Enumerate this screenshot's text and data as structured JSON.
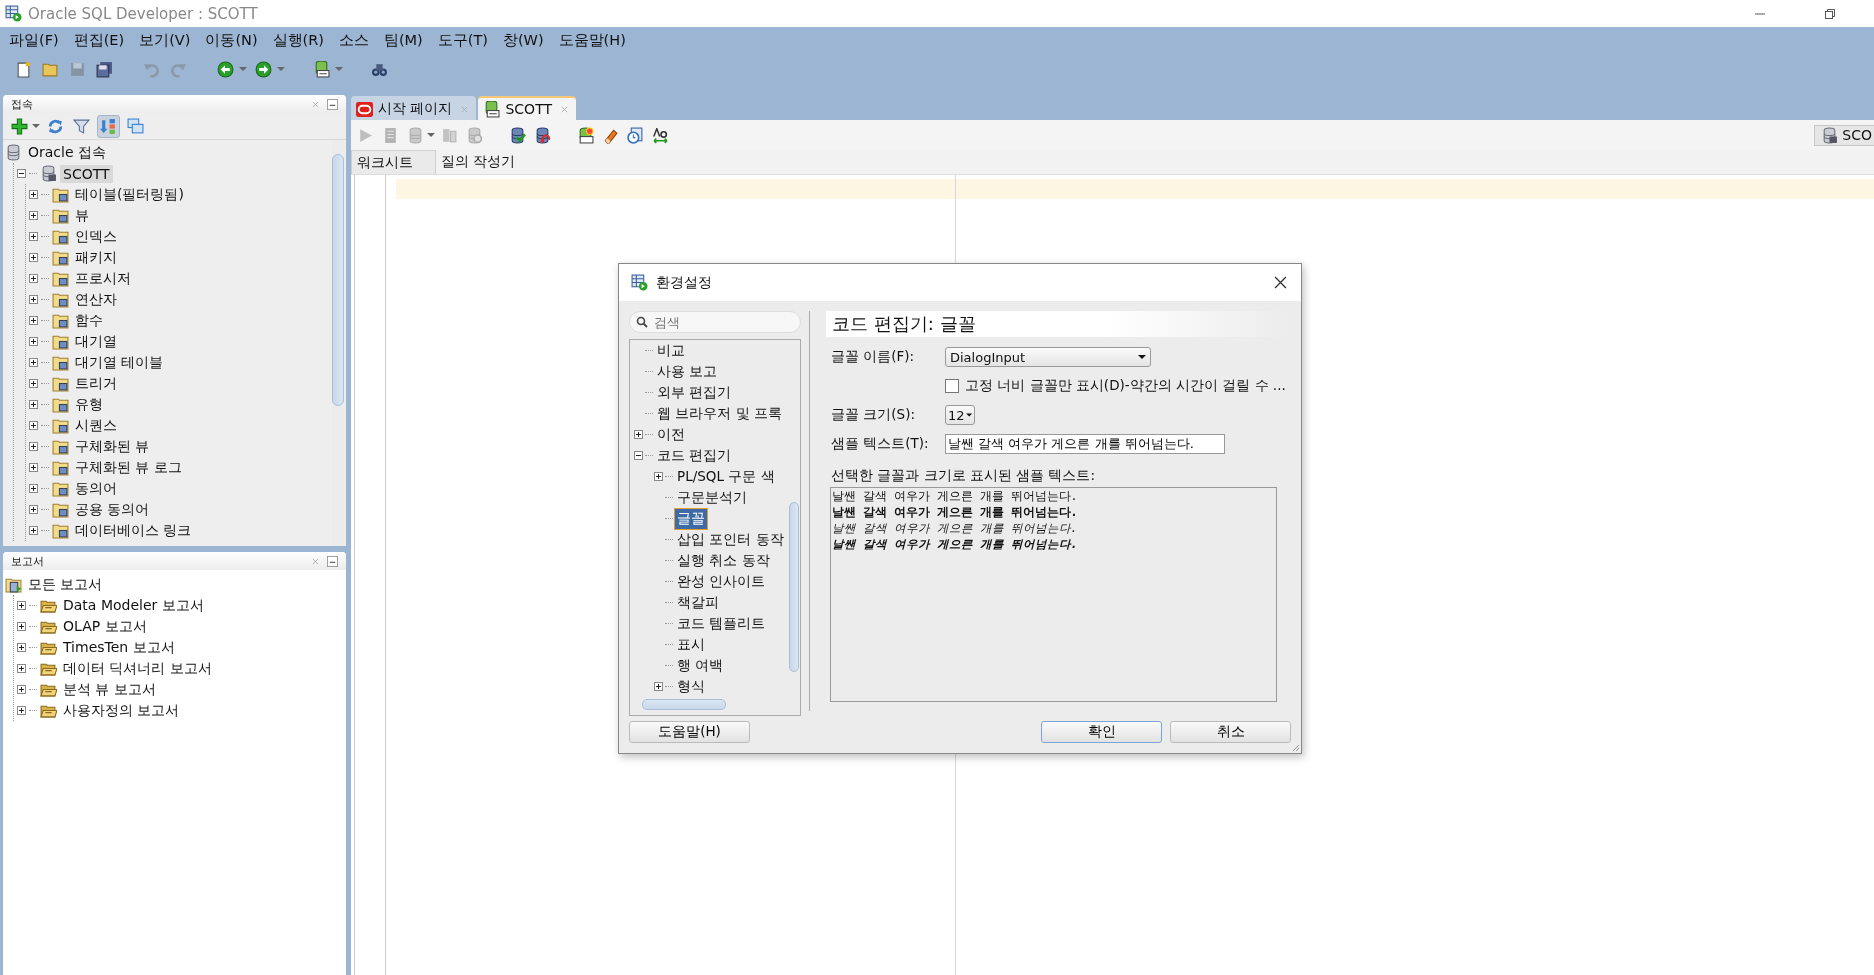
{
  "window": {
    "title": "Oracle SQL Developer : SCOTT"
  },
  "menu": [
    "파일(F)",
    "편집(E)",
    "보기(V)",
    "이동(N)",
    "실행(R)",
    "소스",
    "팀(M)",
    "도구(T)",
    "창(W)",
    "도움말(H)"
  ],
  "toolbar": [
    {
      "kind": "new-file",
      "disabled": false,
      "dropdown": false
    },
    {
      "kind": "open",
      "disabled": false,
      "dropdown": false
    },
    {
      "kind": "save",
      "disabled": true,
      "dropdown": false
    },
    {
      "kind": "save-all",
      "disabled": false,
      "dropdown": false
    },
    {
      "kind": "undo",
      "disabled": true,
      "dropdown": false
    },
    {
      "kind": "redo",
      "disabled": true,
      "dropdown": false
    },
    {
      "kind": "back",
      "disabled": false,
      "dropdown": true
    },
    {
      "kind": "forward",
      "disabled": false,
      "dropdown": true
    },
    {
      "kind": "sql",
      "disabled": false,
      "dropdown": true
    },
    {
      "kind": "find",
      "disabled": false,
      "dropdown": false
    }
  ],
  "connections_panel": {
    "title": "접속",
    "toolbar": [
      {
        "kind": "add",
        "on": false,
        "dropdown": true
      },
      {
        "kind": "refresh",
        "on": false,
        "dropdown": false
      },
      {
        "kind": "filter",
        "on": false,
        "dropdown": false
      },
      {
        "kind": "schema",
        "on": true,
        "dropdown": false
      },
      {
        "kind": "collapse",
        "on": false,
        "dropdown": false
      }
    ],
    "tree": [
      {
        "label": "Oracle 접속",
        "kind": "database",
        "selected": false,
        "children": [
          {
            "label": "SCOTT",
            "kind": "connection",
            "selected": true,
            "expanded": true,
            "children": [
              {
                "label": "테이블(필터링됨)",
                "kind": "folder",
                "selected": false,
                "expanded": false
              },
              {
                "label": "뷰",
                "kind": "folder",
                "selected": false,
                "expanded": false
              },
              {
                "label": "인덱스",
                "kind": "folder",
                "selected": false,
                "expanded": false
              },
              {
                "label": "패키지",
                "kind": "folder",
                "selected": false,
                "expanded": false
              },
              {
                "label": "프로시저",
                "kind": "folder",
                "selected": false,
                "expanded": false
              },
              {
                "label": "연산자",
                "kind": "folder",
                "selected": false,
                "expanded": false
              },
              {
                "label": "함수",
                "kind": "folder",
                "selected": false,
                "expanded": false
              },
              {
                "label": "대기열",
                "kind": "folder",
                "selected": false,
                "expanded": false
              },
              {
                "label": "대기열 테이블",
                "kind": "folder",
                "selected": false,
                "expanded": false
              },
              {
                "label": "트리거",
                "kind": "folder",
                "selected": false,
                "expanded": false
              },
              {
                "label": "유형",
                "kind": "folder",
                "selected": false,
                "expanded": false
              },
              {
                "label": "시퀀스",
                "kind": "folder",
                "selected": false,
                "expanded": false
              },
              {
                "label": "구체화된 뷰",
                "kind": "folder",
                "selected": false,
                "expanded": false
              },
              {
                "label": "구체화된 뷰 로그",
                "kind": "folder",
                "selected": false,
                "expanded": false
              },
              {
                "label": "동의어",
                "kind": "folder",
                "selected": false,
                "expanded": false
              },
              {
                "label": "공용 동의어",
                "kind": "folder",
                "selected": false,
                "expanded": false
              },
              {
                "label": "데이터베이스 링크",
                "kind": "folder",
                "selected": false,
                "expanded": false
              }
            ]
          }
        ]
      }
    ]
  },
  "reports_panel": {
    "title": "보고서",
    "tree": [
      {
        "label": "모든 보고서",
        "kind": "reports",
        "selected": false,
        "children": [
          {
            "label": "Data Modeler 보고서",
            "kind": "report-folder",
            "selected": false,
            "expanded": false
          },
          {
            "label": "OLAP 보고서",
            "kind": "report-folder",
            "selected": false,
            "expanded": false
          },
          {
            "label": "TimesTen 보고서",
            "kind": "report-folder",
            "selected": false,
            "expanded": false
          },
          {
            "label": "데이터 딕셔너리 보고서",
            "kind": "report-folder",
            "selected": false,
            "expanded": false
          },
          {
            "label": "분석 뷰 보고서",
            "kind": "report-folder",
            "selected": false,
            "expanded": false
          },
          {
            "label": "사용자정의 보고서",
            "kind": "report-folder",
            "selected": false,
            "expanded": false
          }
        ]
      }
    ]
  },
  "editor": {
    "tabs": [
      {
        "label": "시작 페이지",
        "kind": "start",
        "selected": false
      },
      {
        "label": "SCOTT",
        "kind": "worksheet",
        "selected": true
      }
    ],
    "toolbar": [
      {
        "kind": "run",
        "disabled": true,
        "dropdown": false
      },
      {
        "kind": "run-script",
        "disabled": true,
        "dropdown": false
      },
      {
        "kind": "explain",
        "disabled": true,
        "dropdown": true
      },
      {
        "kind": "autotrace",
        "disabled": true,
        "dropdown": false
      },
      {
        "kind": "tune",
        "disabled": true,
        "dropdown": false
      },
      {
        "kind": "commit",
        "disabled": false,
        "dropdown": false
      },
      {
        "kind": "rollback",
        "disabled": false,
        "dropdown": false
      },
      {
        "kind": "unshared",
        "disabled": false,
        "dropdown": false
      },
      {
        "kind": "clear",
        "disabled": false,
        "dropdown": false
      },
      {
        "kind": "history",
        "disabled": false,
        "dropdown": false
      },
      {
        "kind": "format",
        "disabled": false,
        "dropdown": false
      }
    ],
    "connection_button": "SCO",
    "subtabs": [
      {
        "label": "워크시트",
        "selected": true
      },
      {
        "label": "질의 작성기",
        "selected": false
      }
    ]
  },
  "dialog": {
    "title": "환경설정",
    "search": {
      "placeholder": "검색"
    },
    "tree": [
      {
        "label": "비교",
        "selected": false
      },
      {
        "label": "사용 보고",
        "selected": false
      },
      {
        "label": "외부 편집기",
        "selected": false
      },
      {
        "label": "웹 브라우저 및 프록",
        "selected": false
      },
      {
        "label": "이전",
        "selected": false,
        "expanded": false
      },
      {
        "label": "코드 편집기",
        "selected": false,
        "expanded": true,
        "children": [
          {
            "label": "PL/SQL 구문 색",
            "selected": false,
            "expanded": false
          },
          {
            "label": "구문분석기",
            "selected": false
          },
          {
            "label": "글꼴",
            "selected": true
          },
          {
            "label": "삽입 포인터 동작",
            "selected": false
          },
          {
            "label": "실행 취소 동작",
            "selected": false
          },
          {
            "label": "완성 인사이트",
            "selected": false
          },
          {
            "label": "책갈피",
            "selected": false
          },
          {
            "label": "코드 템플리트",
            "selected": false
          },
          {
            "label": "표시",
            "selected": false
          },
          {
            "label": "행 여백",
            "selected": false
          },
          {
            "label": "형식",
            "selected": false,
            "expanded": false
          }
        ]
      }
    ],
    "heading": "코드 편집기: 글꼴",
    "font_name": {
      "label": "글꼴 이름(F):",
      "value": "DialogInput"
    },
    "fixed_width": {
      "label": "고정 너비 글꼴만 표시(D)-약간의 시간이 걸릴 수 ...",
      "checked": false
    },
    "font_size": {
      "label": "글꼴 크기(S):",
      "value": "12"
    },
    "sample_text": {
      "label": "샘플 텍스트(T):",
      "value": "날쌘 갈색 여우가 게으른 개를 뛰어넘는다."
    },
    "preview": {
      "label": "선택한 글꼴과 크기로 표시된 샘플 텍스트:",
      "lines": [
        {
          "text": "날쌘 갈색 여우가 게으른 개를 뛰어넘는다.",
          "kind": "plain"
        },
        {
          "text": "날쌘 갈색 여우가 게으른 개를 뛰어넘는다.",
          "kind": "bold"
        },
        {
          "text": "날쌘 갈색 여우가 게으른 개를 뛰어넘는다.",
          "kind": "italic"
        },
        {
          "text": "날쌘 갈색 여우가 게으른 개를 뛰어넘는다.",
          "kind": "bold-italic"
        }
      ]
    },
    "buttons": [
      {
        "label": "도움말(H)",
        "kind": "help"
      },
      {
        "label": "확인",
        "kind": "ok"
      },
      {
        "label": "취소",
        "kind": "cancel"
      }
    ]
  }
}
